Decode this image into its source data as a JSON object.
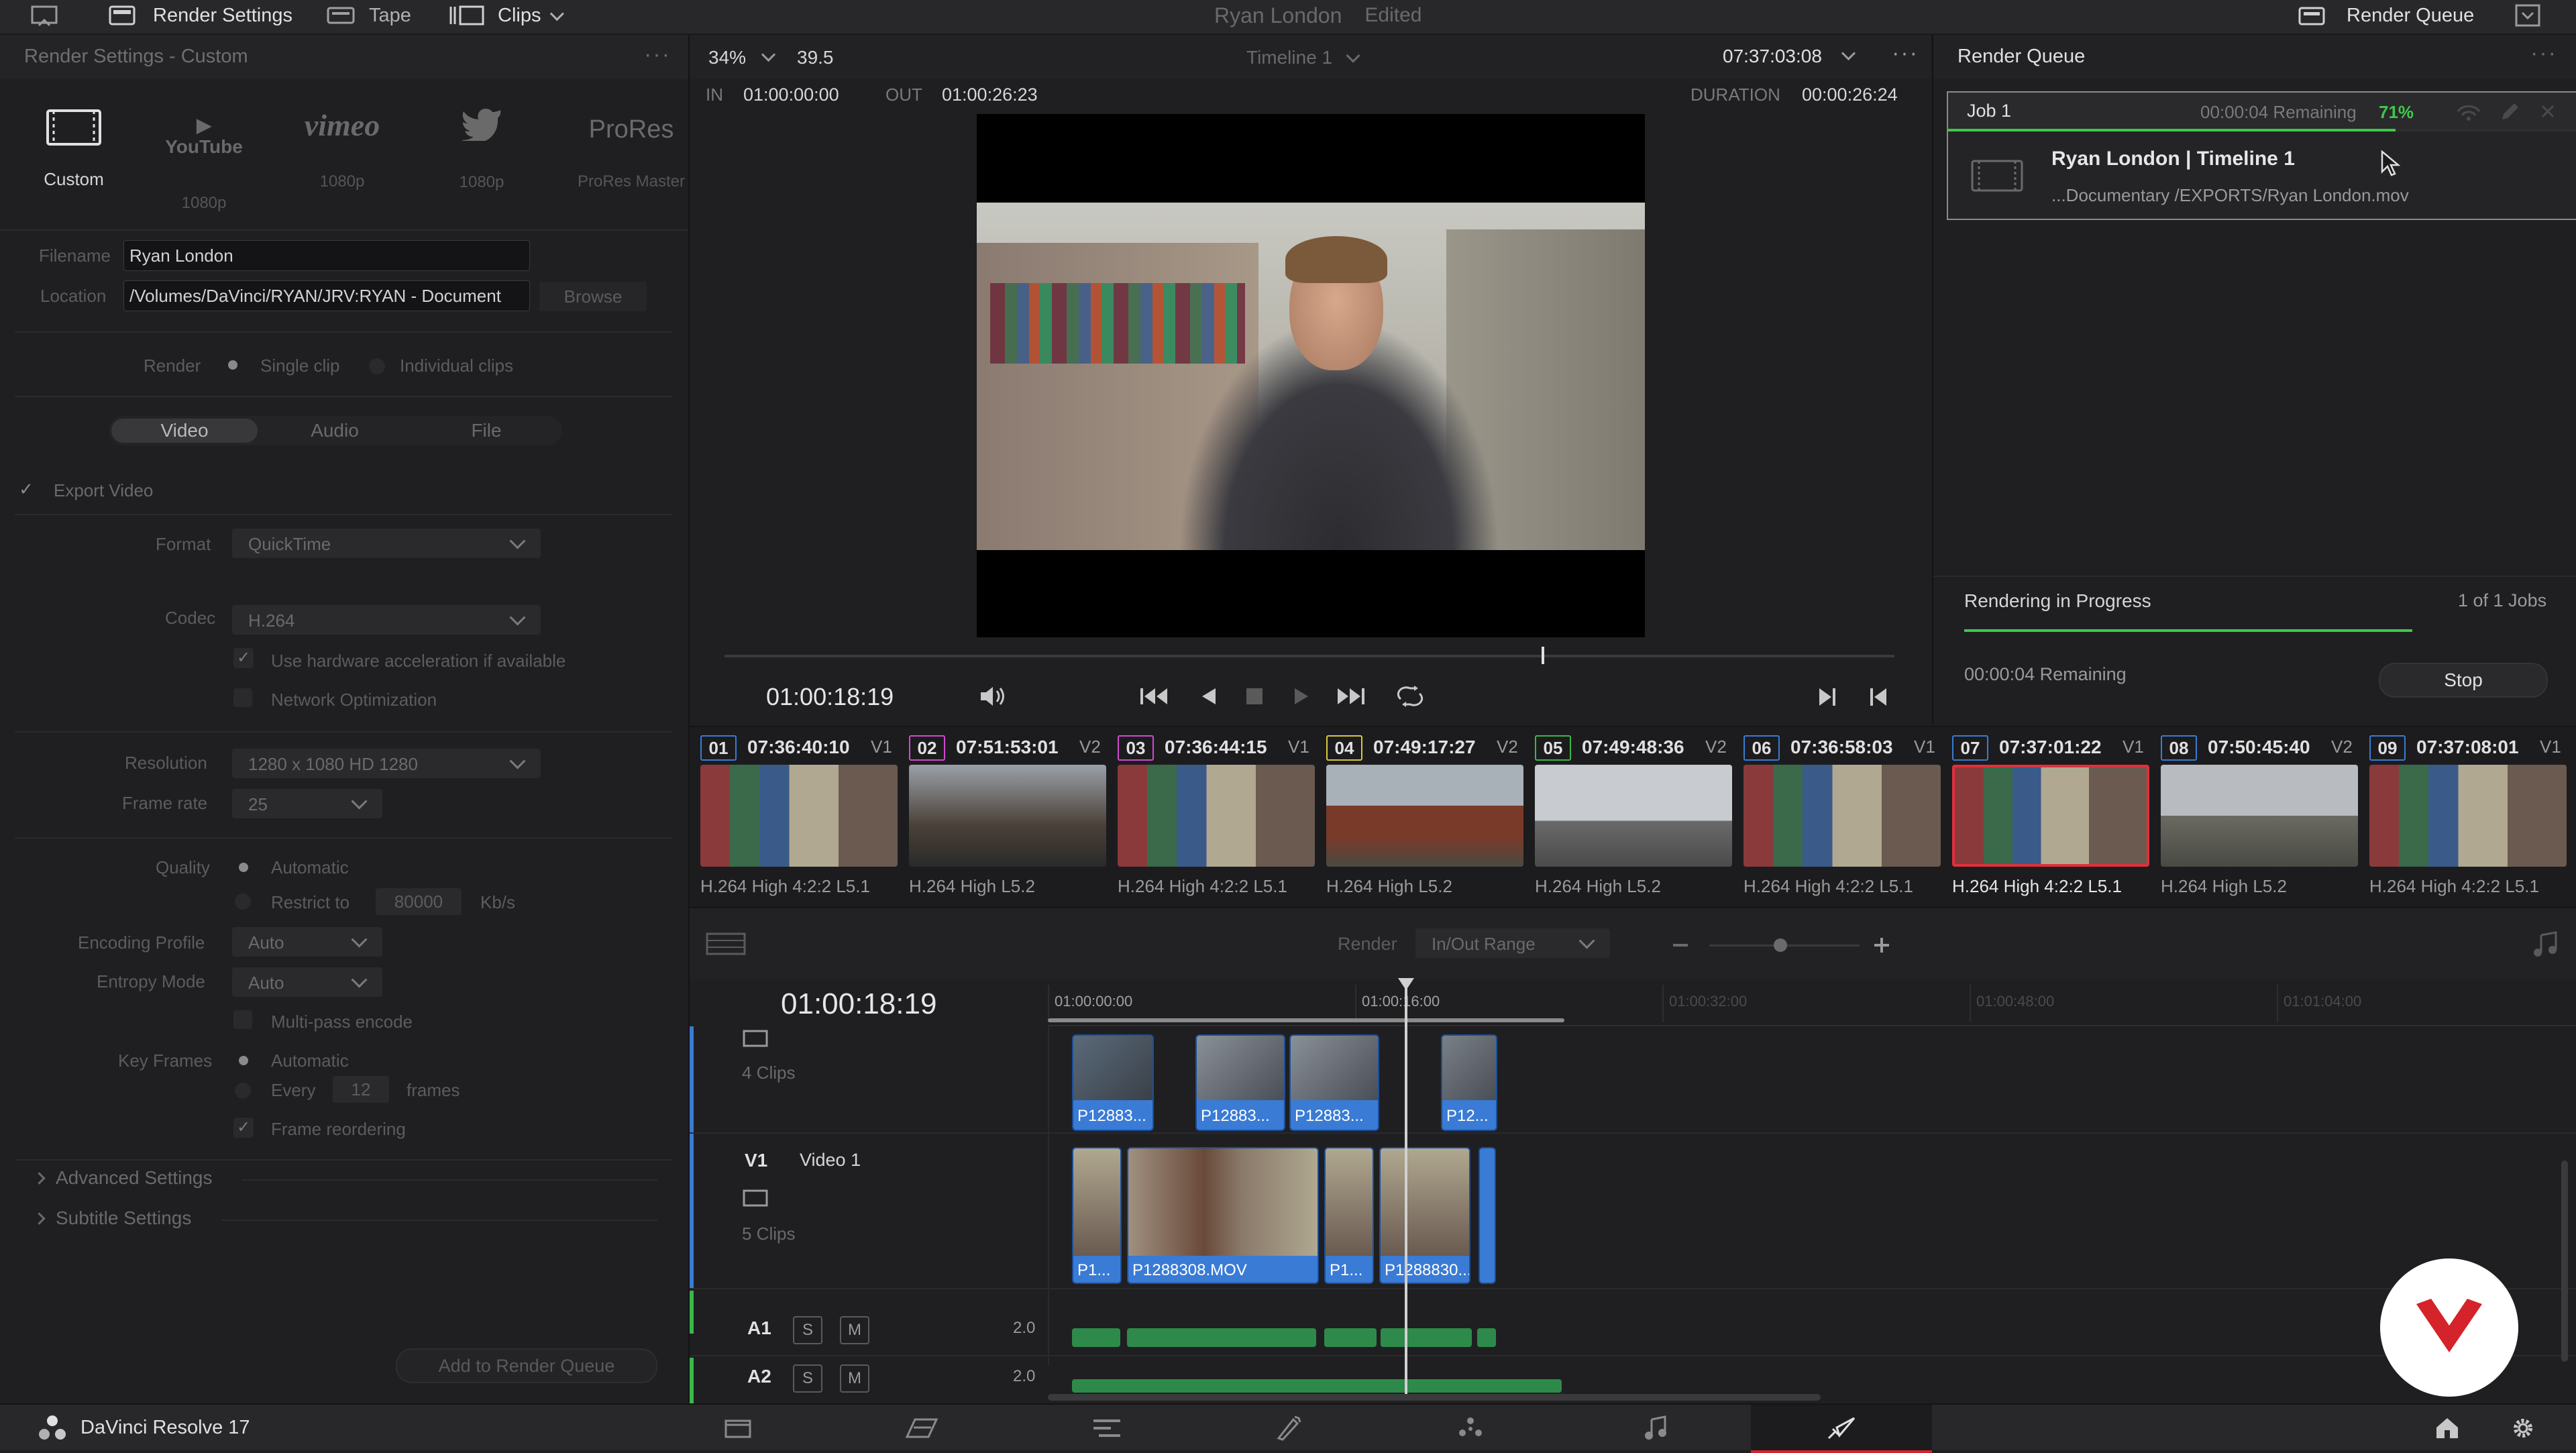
{
  "topbar": {
    "render_settings": "Render Settings",
    "tape": "Tape",
    "clips": "Clips",
    "project_name": "Ryan London",
    "edited": "Edited",
    "render_queue": "Render Queue"
  },
  "render_settings": {
    "title": "Render Settings - Custom",
    "presets": [
      {
        "name": "Custom",
        "sub": ""
      },
      {
        "name": "YouTube",
        "sub": "1080p"
      },
      {
        "name": "vimeo",
        "sub": "1080p"
      },
      {
        "name": "Twitter",
        "sub": "1080p"
      },
      {
        "name": "ProRes",
        "sub": "ProRes Master"
      }
    ],
    "filename_label": "Filename",
    "filename_value": "Ryan London",
    "location_label": "Location",
    "location_value": "/Volumes/DaVinci/RYAN/JRV:RYAN - Document",
    "browse": "Browse",
    "render_label": "Render",
    "single_clip": "Single clip",
    "individual_clips": "Individual clips",
    "tabs": [
      "Video",
      "Audio",
      "File"
    ],
    "export_video": "Export Video",
    "format_label": "Format",
    "format_value": "QuickTime",
    "codec_label": "Codec",
    "codec_value": "H.264",
    "hw_accel": "Use hardware acceleration if available",
    "network_opt": "Network Optimization",
    "resolution_label": "Resolution",
    "resolution_value": "1280 x 1080 HD 1280",
    "framerate_label": "Frame rate",
    "framerate_value": "25",
    "quality_label": "Quality",
    "quality_auto": "Automatic",
    "restrict_to": "Restrict to",
    "restrict_value": "80000",
    "kbs": "Kb/s",
    "encoding_profile_label": "Encoding Profile",
    "encoding_profile_value": "Auto",
    "entropy_mode_label": "Entropy Mode",
    "entropy_mode_value": "Auto",
    "multipass": "Multi-pass encode",
    "keyframes_label": "Key Frames",
    "keyframes_auto": "Automatic",
    "every": "Every",
    "every_value": "12",
    "frames": "frames",
    "frame_reordering": "Frame reordering",
    "advanced_settings": "Advanced Settings",
    "subtitle_settings": "Subtitle Settings",
    "add_to_queue": "Add to Render Queue"
  },
  "viewer": {
    "zoom": "34%",
    "fps": "39.5",
    "timeline_name": "Timeline 1",
    "timecode_top": "07:37:03:08",
    "in_label": "IN",
    "in_value": "01:00:00:00",
    "out_label": "OUT",
    "out_value": "01:00:26:23",
    "duration_label": "DURATION",
    "duration_value": "00:00:26:24",
    "current_timecode": "01:00:18:19",
    "scrub_progress": 0.7
  },
  "render_queue": {
    "title": "Render Queue",
    "job_label": "Job 1",
    "remaining": "00:00:04 Remaining",
    "percent": "71%",
    "job_title": "Ryan London | Timeline 1",
    "job_path": "...Documentary /EXPORTS/Ryan London.mov",
    "rendering_status": "Rendering in Progress",
    "jobs_count": "1 of 1 Jobs",
    "progress": 0.71,
    "remaining_bottom": "00:00:04 Remaining",
    "stop": "Stop"
  },
  "clips": [
    {
      "num": "01",
      "tc": "07:36:40:10",
      "track": "V1",
      "codec": "H.264 High 4:2:2 L5.1",
      "color": "#3a7bd5"
    },
    {
      "num": "02",
      "tc": "07:51:53:01",
      "track": "V2",
      "codec": "H.264 High L5.2",
      "color": "#d04ad0"
    },
    {
      "num": "03",
      "tc": "07:36:44:15",
      "track": "V1",
      "codec": "H.264 High 4:2:2 L5.1",
      "color": "#d04ad0"
    },
    {
      "num": "04",
      "tc": "07:49:17:27",
      "track": "V2",
      "codec": "H.264 High L5.2",
      "color": "#d8c83a"
    },
    {
      "num": "05",
      "tc": "07:49:48:36",
      "track": "V2",
      "codec": "H.264 High L5.2",
      "color": "#3ab84a"
    },
    {
      "num": "06",
      "tc": "07:36:58:03",
      "track": "V1",
      "codec": "H.264 High 4:2:2 L5.1",
      "color": "#3a7bd5"
    },
    {
      "num": "07",
      "tc": "07:37:01:22",
      "track": "V1",
      "codec": "H.264 High 4:2:2 L5.1",
      "color": "#3a7bd5"
    },
    {
      "num": "08",
      "tc": "07:50:45:40",
      "track": "V2",
      "codec": "H.264 High L5.2",
      "color": "#3a7bd5"
    },
    {
      "num": "09",
      "tc": "07:37:08:01",
      "track": "V1",
      "codec": "H.264 High 4:2:2 L5.1",
      "color": "#3a7bd5"
    }
  ],
  "timeline": {
    "render_label": "Render",
    "range_value": "In/Out Range",
    "timecode": "01:00:18:19",
    "ruler": [
      "01:00:00:00",
      "01:00:16:00",
      "01:00:32:00",
      "01:00:48:00",
      "01:01:04:00"
    ],
    "v2_clips_count": "4 Clips",
    "v2_clip_names": [
      "P12883...",
      "P12883...",
      "P12883...",
      "P12..."
    ],
    "v1_label": "V1",
    "v1_name": "Video 1",
    "v1_clips_count": "5 Clips",
    "v1_clip_names": [
      "P1...",
      "P1288308.MOV",
      "P1...",
      "P1288830..."
    ],
    "a1_label": "A1",
    "a1_level": "2.0",
    "a2_label": "A2",
    "a2_level": "2.0",
    "solo": "S",
    "mute": "M"
  },
  "bottombar": {
    "app_name": "DaVinci Resolve 17",
    "pages": [
      "media-page-icon",
      "cut-page-icon",
      "edit-page-icon",
      "fusion-page-icon",
      "color-page-icon",
      "fairlight-page-icon",
      "deliver-page-icon"
    ]
  }
}
